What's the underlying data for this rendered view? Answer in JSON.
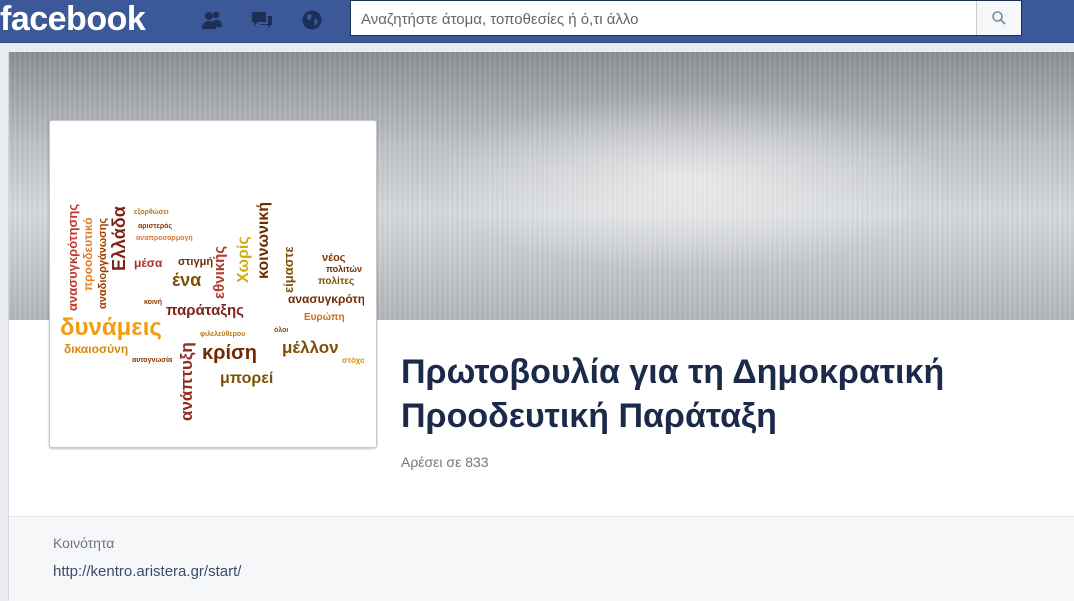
{
  "topbar": {
    "logo_text": "facebook",
    "search_placeholder": "Αναζητήστε άτομα, τοποθεσίες ή ό,τι άλλο",
    "icons": [
      "friends-icon",
      "messages-icon",
      "notifications-globe-icon",
      "search-icon"
    ],
    "brand_color": "#3b5998"
  },
  "page": {
    "title_line1": "Πρωτοβουλία για τη Δημοκρατική",
    "title_line2": "Προοδευτική Παράταξη",
    "likes": "Αρέσει σε 833",
    "category": "Κοινότητα",
    "website": "http://kentro.aristera.gr/start/"
  },
  "profile_picture": {
    "words": [
      "αναδιοργάνωσης",
      "προοδευτικό",
      "ανασυγκρότησης",
      "δυνάμεις",
      "δικαιοσύνη",
      "Ελλάδα",
      "εξορθώσει",
      "αριστερός",
      "αναπροσαρμογή",
      "μέσα",
      "στιγμή",
      "ένα",
      "εθνικής",
      "Χωρίς",
      "κοινωνική",
      "νέος",
      "είμαστε",
      "πολίτες",
      "ανασυγκρότηση",
      "Ευρώπη",
      "παράταξης",
      "κρίση",
      "ανάπτυξη",
      "μέλλον",
      "μπορεί",
      "φιλελεύθερου",
      "αυτογνωσία",
      "κοινή",
      "στόχο",
      "πολιτών",
      "όλοι"
    ]
  }
}
